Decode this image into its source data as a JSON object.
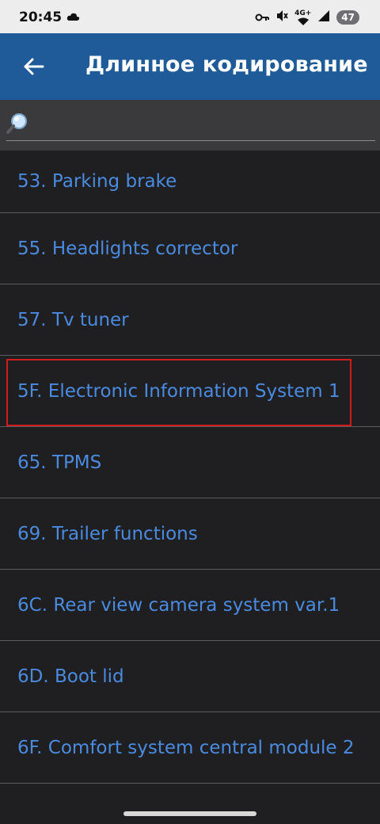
{
  "status_bar": {
    "time": "20:45",
    "network_label": "4G+",
    "battery_level": "47",
    "icons": [
      "cloud-icon",
      "key-icon",
      "mute-icon",
      "wifi-icon",
      "signal-icon",
      "battery-icon"
    ]
  },
  "app_bar": {
    "title": "Длинное кодирование",
    "background_color": "#1f5b98"
  },
  "search": {
    "value": "",
    "placeholder": ""
  },
  "list": {
    "text_color": "#4a8be0",
    "items": [
      {
        "label": "53. Parking brake"
      },
      {
        "label": "55. Headlights corrector"
      },
      {
        "label": "57. Tv tuner"
      },
      {
        "label": "5F. Electronic Information System 1",
        "highlighted": true
      },
      {
        "label": "65. TPMS"
      },
      {
        "label": "69. Trailer functions"
      },
      {
        "label": "6C. Rear view camera system var.1"
      },
      {
        "label": "6D. Boot lid"
      },
      {
        "label": "6F. Comfort system central module 2"
      }
    ]
  },
  "highlight_color": "#d21c1c"
}
